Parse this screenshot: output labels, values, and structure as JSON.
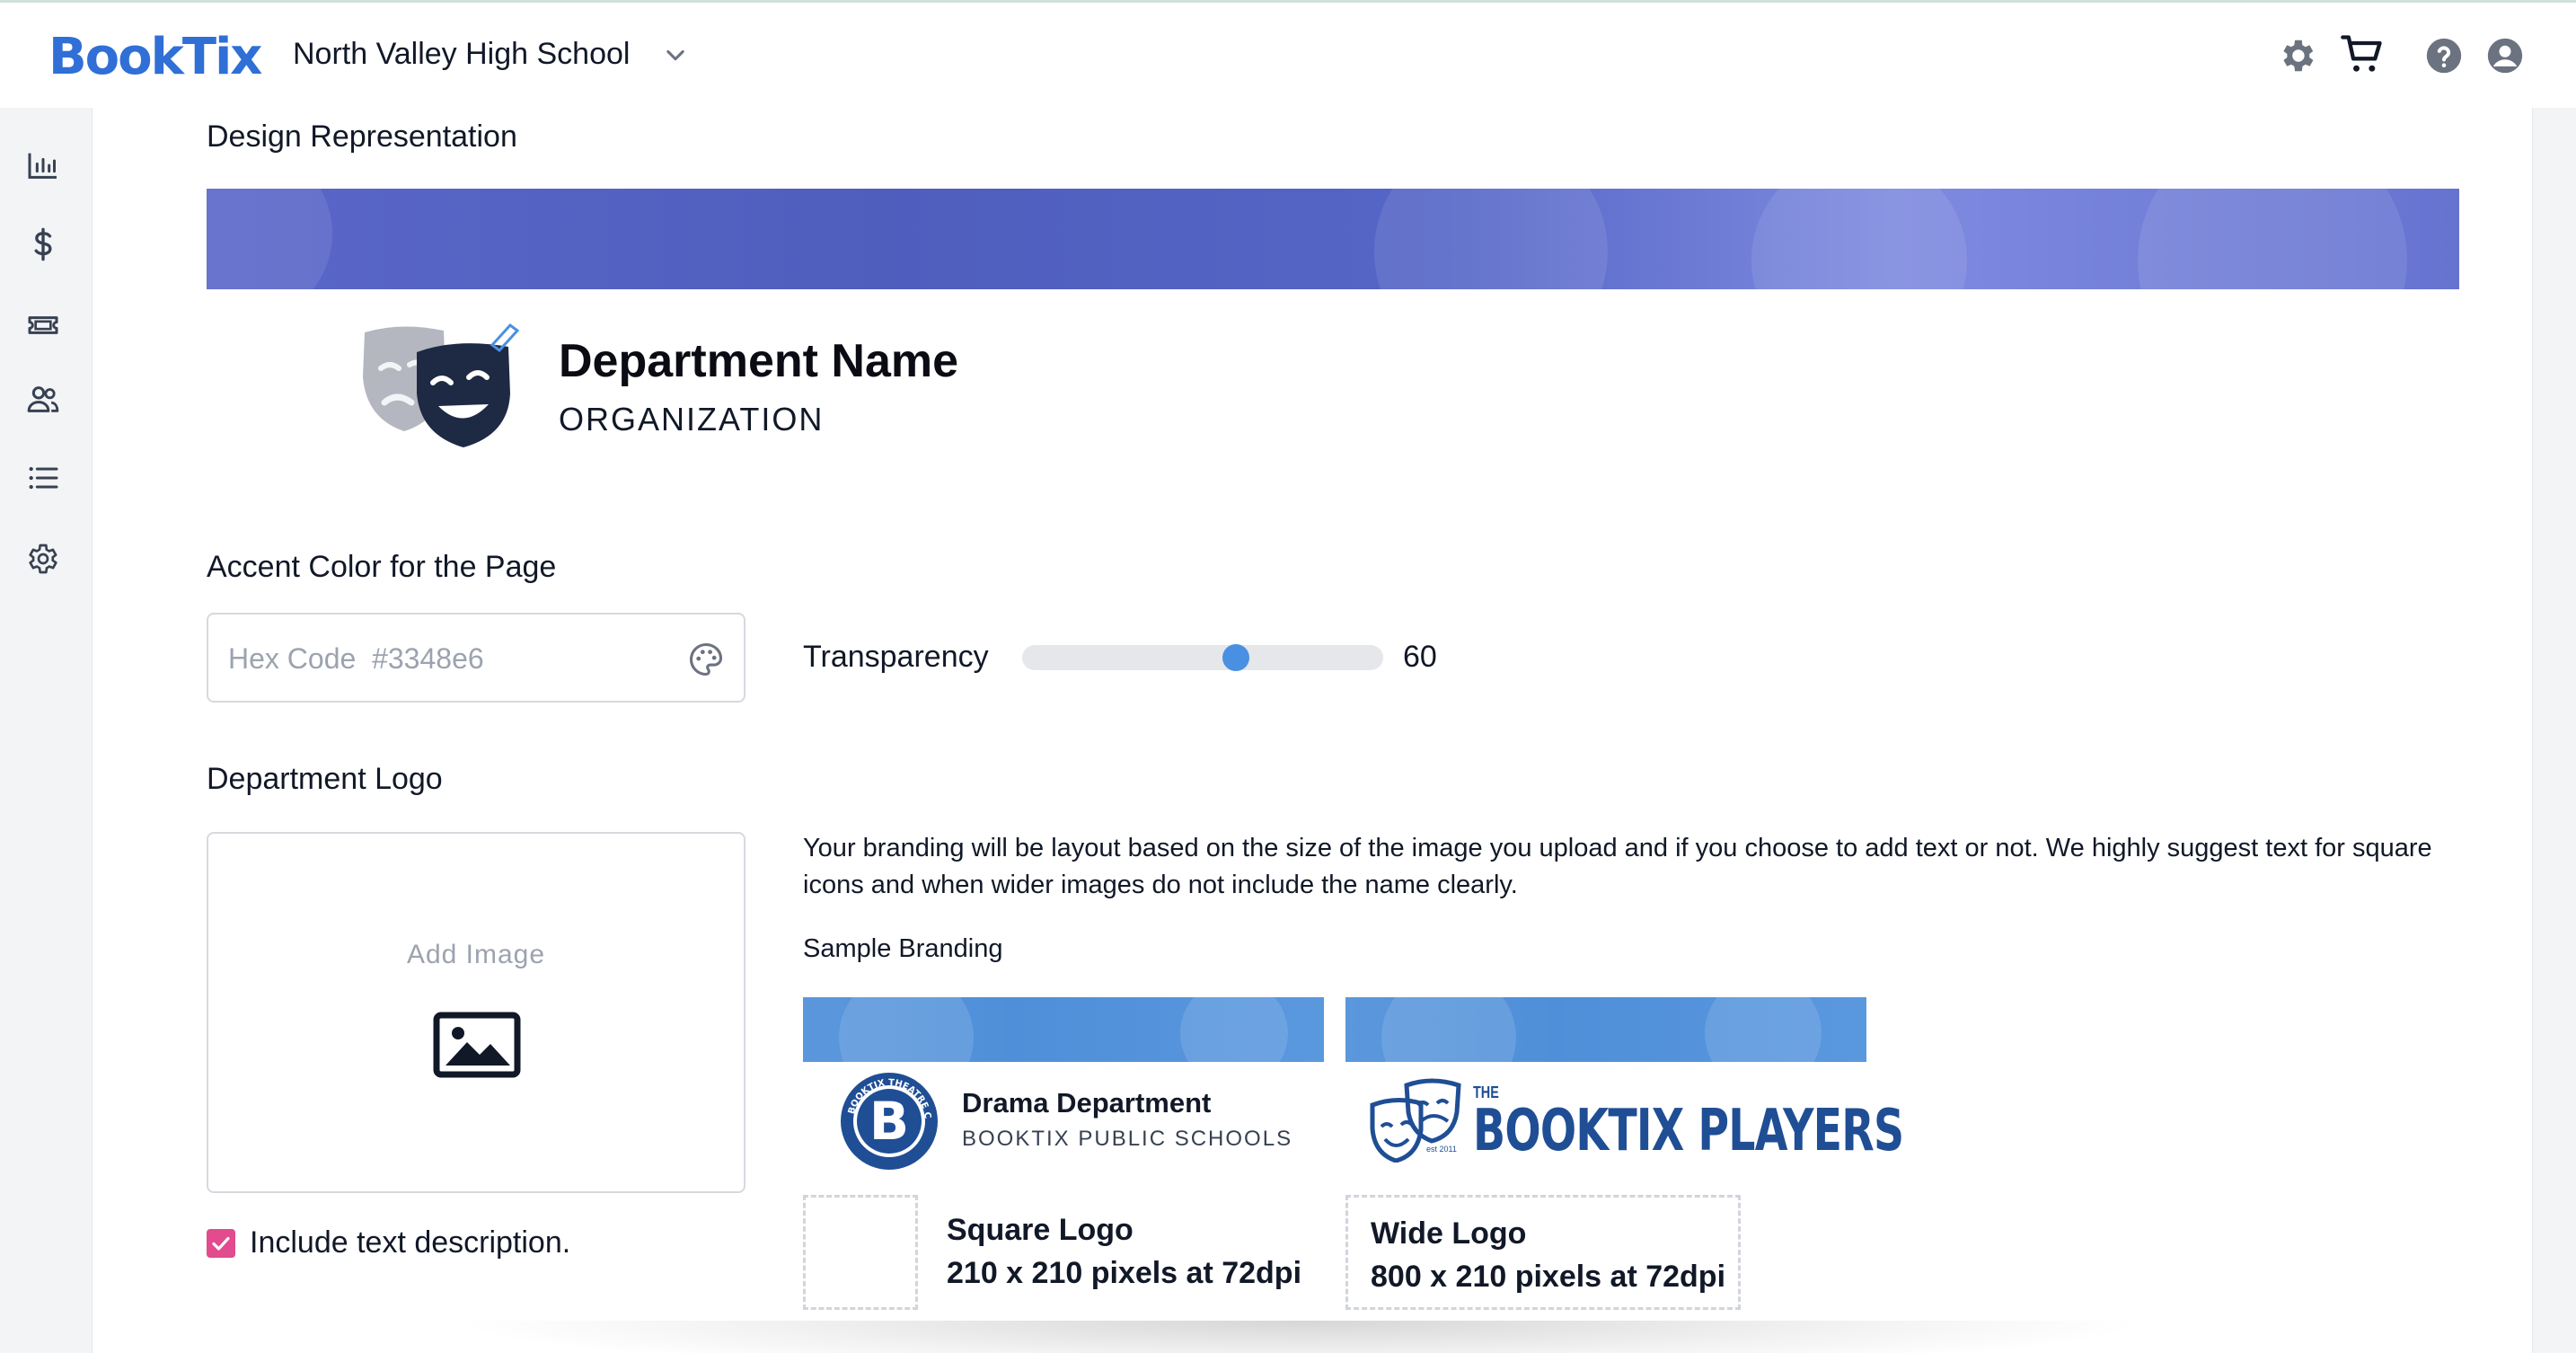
{
  "header": {
    "brand": "BookTix",
    "school": "North Valley High School"
  },
  "main": {
    "design_heading": "Design Representation",
    "preview": {
      "department_name": "Department Name",
      "organization": "ORGANIZATION"
    },
    "accent": {
      "heading": "Accent Color for the Page",
      "hex_placeholder": "Hex Code  #3348e6",
      "transparency_label": "Transparency",
      "transparency_value": "60"
    },
    "logo": {
      "heading": "Department Logo",
      "add_image": "Add Image",
      "include_text_label": "Include text description.",
      "include_text_checked": true,
      "description": "Your branding will be layout based on the size of the image you upload and if you choose to add text or not. We highly suggest text for square icons and when wider images do not include the name clearly.",
      "sample_label": "Sample Branding",
      "square_sample": {
        "badge_letter": "B",
        "badge_ring_text": "BOOKTIX THEATRE CO.",
        "title": "Drama Department",
        "subtitle": "BOOKTIX PUBLIC SCHOOLS",
        "caption_title": "Square Logo",
        "caption_spec": "210 x 210 pixels at 72dpi"
      },
      "wide_sample": {
        "the": "THE",
        "name": "BOOKTIX PLAYERS",
        "est": "est 2011",
        "caption_title": "Wide Logo",
        "caption_spec": "800 x 210 pixels at 72dpi"
      }
    }
  },
  "colors": {
    "brand_blue": "#2f6fd6",
    "slider_thumb": "#4a90e2",
    "checkbox": "#e24b8d",
    "banner": "#5a67c9",
    "sample_banner": "#5b97dc",
    "mask_dark": "#1e2a44",
    "mask_grey": "#b4b7bf"
  },
  "icons": {
    "sidebar": [
      "chart-icon",
      "dollar-icon",
      "ticket-icon",
      "users-icon",
      "list-icon",
      "settings-icon"
    ],
    "topbar": [
      "gear-icon",
      "cart-icon",
      "help-icon",
      "account-icon"
    ]
  }
}
